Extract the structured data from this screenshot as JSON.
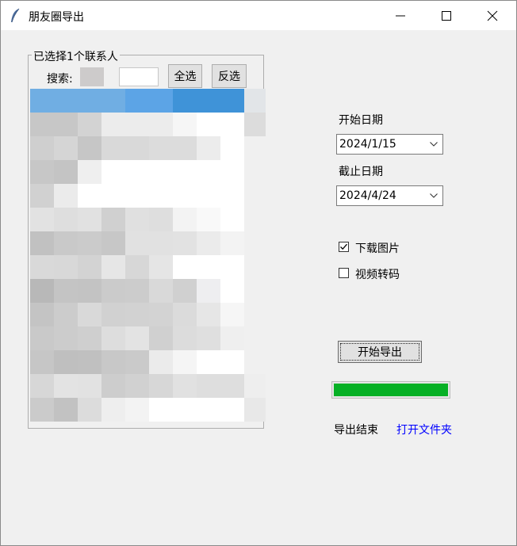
{
  "window": {
    "title": "朋友圈导出",
    "icon": "feather-icon",
    "controls": [
      "minimize-icon",
      "maximize-icon",
      "close-icon"
    ]
  },
  "contacts_panel": {
    "legend": "已选择1个联系人",
    "search_label": "搜索:",
    "search_value": "",
    "select_all_label": "全选",
    "invert_label": "反选",
    "grid_colors": [
      [
        "#70aee3",
        "#70aee3",
        "#70aee3",
        "#70aee3",
        "#5ca4e6",
        "#5ca4e6",
        "#3f93d8",
        "#3f93d8",
        "#3f93d8",
        "#e2e5e8"
      ],
      [
        "#c7c7c7",
        "#c7c7c7",
        "#d3d3d3",
        "#ececec",
        "#ececec",
        "#ececec",
        "#f6f6f6",
        "#ffffff",
        "#ffffff",
        "#dcdcdc"
      ],
      [
        "#cfcfcf",
        "#d5d5d5",
        "#c6c6c6",
        "#d9d9d9",
        "#d9d9d9",
        "#dcdcdc",
        "#dcdcdc",
        "#ececec",
        "#ffffff",
        "#f0f0f0"
      ],
      [
        "#c7c7c7",
        "#c4c4c4",
        "#efefef",
        "#ffffff",
        "#ffffff",
        "#ffffff",
        "#ffffff",
        "#ffffff",
        "#ffffff",
        "#f0f0f0"
      ],
      [
        "#d1d1d1",
        "#ebebeb",
        "#ffffff",
        "#ffffff",
        "#ffffff",
        "#ffffff",
        "#ffffff",
        "#ffffff",
        "#ffffff",
        "#f0f0f0"
      ],
      [
        "#e2e2e2",
        "#dedede",
        "#e1e1e1",
        "#d0d0d0",
        "#e0e0e0",
        "#dedede",
        "#f3f3f3",
        "#f9f9f9",
        "#ffffff",
        "#f0f0f0"
      ],
      [
        "#c1c1c1",
        "#c9c9c9",
        "#cbcbcb",
        "#c7c7c7",
        "#e1e1e1",
        "#e1e1e1",
        "#e2e2e2",
        "#ebebeb",
        "#f3f3f3",
        "#f0f0f0"
      ],
      [
        "#d9d9d9",
        "#d8d8d8",
        "#d3d3d3",
        "#e6e6e6",
        "#d7d7d7",
        "#e5e5e5",
        "#ffffff",
        "#ffffff",
        "#ffffff",
        "#f0f0f0"
      ],
      [
        "#b8b8b8",
        "#c4c4c4",
        "#c3c3c3",
        "#cbcbcb",
        "#cccccc",
        "#d9d9d9",
        "#d0d0d0",
        "#eeeef0",
        "#ffffff",
        "#f0f0f0"
      ],
      [
        "#c4c4c4",
        "#cccccc",
        "#d9d9d9",
        "#d1d1d1",
        "#d2d2d2",
        "#d3d3d3",
        "#dbdbdb",
        "#e6e6e6",
        "#f6f6f6",
        "#f0f0f0"
      ],
      [
        "#c9c9c9",
        "#cccccc",
        "#cfcfcf",
        "#dddddd",
        "#e3e3e3",
        "#d0d0d0",
        "#dcdcdc",
        "#dfdfdf",
        "#efefef",
        "#f0f0f0"
      ],
      [
        "#c6c6c6",
        "#bfbfbf",
        "#c0c0c0",
        "#c8c8c8",
        "#cacaca",
        "#ebebeb",
        "#f5f5f5",
        "#ffffff",
        "#ffffff",
        "#f0f0f0"
      ],
      [
        "#d7d7d7",
        "#e3e3e3",
        "#e2e2e2",
        "#cdcdcd",
        "#d1d1d1",
        "#d7d7d7",
        "#e1e1e1",
        "#dedede",
        "#dedede",
        "#eeeeee"
      ],
      [
        "#cbcbcb",
        "#c2c2c2",
        "#dcdcdc",
        "#eeeeee",
        "#f3f3f3",
        "#ffffff",
        "#ffffff",
        "#ffffff",
        "#ffffff",
        "#e8e8e8"
      ]
    ]
  },
  "date_range": {
    "start_label": "开始日期",
    "start_value": "2024/1/15",
    "end_label": "截止日期",
    "end_value": "2024/4/24"
  },
  "options": {
    "download_images": {
      "label": "下载图片",
      "checked": true
    },
    "transcode_video": {
      "label": "视频转码",
      "checked": false
    }
  },
  "actions": {
    "export_label": "开始导出"
  },
  "progress": {
    "percent": 100,
    "fill_color": "#06b025"
  },
  "status": {
    "text": "导出结束",
    "open_folder_label": "打开文件夹",
    "link_color": "#0000ff"
  }
}
